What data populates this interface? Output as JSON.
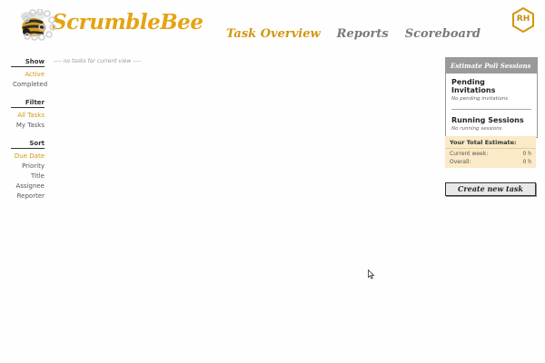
{
  "header": {
    "logo_text": "ScrumbleBee",
    "nav": [
      {
        "label": "Task Overview",
        "active": true
      },
      {
        "label": "Reports",
        "active": false
      },
      {
        "label": "Scoreboard",
        "active": false
      }
    ],
    "avatar_initials": "RH"
  },
  "sidebar": {
    "show": {
      "title": "Show",
      "items": [
        {
          "label": "Active",
          "active": true
        },
        {
          "label": "Completed",
          "active": false
        }
      ]
    },
    "filter": {
      "title": "Filter",
      "items": [
        {
          "label": "All Tasks",
          "active": true
        },
        {
          "label": "My Tasks",
          "active": false
        }
      ]
    },
    "sort": {
      "title": "Sort",
      "items": [
        {
          "label": "Due Date",
          "active": true
        },
        {
          "label": "Priority",
          "active": false
        },
        {
          "label": "Title",
          "active": false
        },
        {
          "label": "Assignee",
          "active": false
        },
        {
          "label": "Reporter",
          "active": false
        }
      ]
    }
  },
  "main": {
    "empty_message": "---- no tasks for current view ----"
  },
  "poll_sessions": {
    "title": "Estimate Poll Sessions",
    "pending_title": "Pending Invitations",
    "pending_empty": "No pending invitations",
    "running_title": "Running Sessions",
    "running_empty": "No running sessions"
  },
  "estimate": {
    "title": "Your Total Estimate:",
    "current_label": "Current week:",
    "current_value": "0 h",
    "overall_label": "Overall:",
    "overall_value": "0 h"
  },
  "create_button": "Create new task",
  "colors": {
    "accent": "#d4960e",
    "logo": "#e5a313",
    "estimate_bg": "#fbeac7"
  },
  "icons": {
    "logo": "bee-icon",
    "avatar": "hexagon-icon",
    "cursor": "mouse-pointer-icon"
  }
}
